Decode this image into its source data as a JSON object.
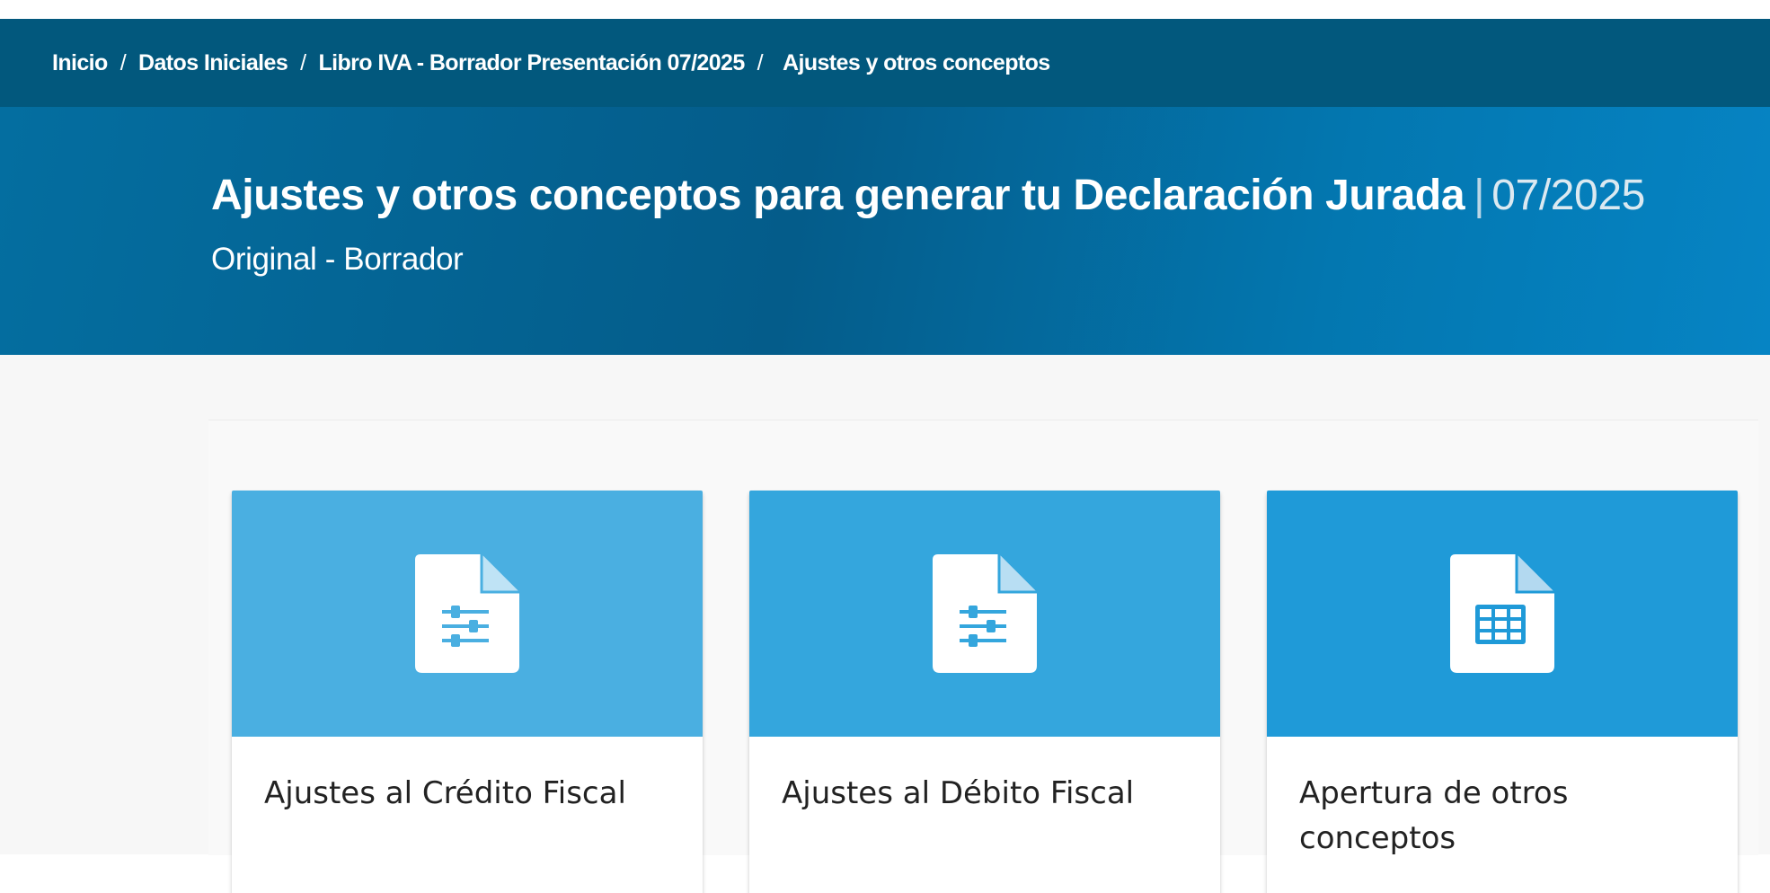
{
  "breadcrumb": {
    "items": [
      "Inicio",
      "Datos Iniciales",
      "Libro IVA - Borrador Presentación 07/2025"
    ],
    "separator": "/",
    "current": "Ajustes y otros conceptos"
  },
  "hero": {
    "title": "Ajustes y otros conceptos para generar tu Declaración Jurada",
    "divider": "|",
    "period": "07/2025",
    "subtitle": "Original - Borrador"
  },
  "cards": [
    {
      "label": "Ajustes al Crédito Fiscal",
      "icon": "document-sliders-icon",
      "color": "#4aafe1"
    },
    {
      "label": "Ajustes al Débito Fiscal",
      "icon": "document-sliders-icon",
      "color": "#34a6dd"
    },
    {
      "label": "Apertura de otros conceptos",
      "icon": "document-table-icon",
      "color": "#1f9ad8"
    }
  ],
  "colors": {
    "breadcrumb_bar": "#02587d",
    "hero_gradient_start": "#046ea0",
    "hero_gradient_end": "#0684c4",
    "content_background": "#f7f7f7"
  }
}
